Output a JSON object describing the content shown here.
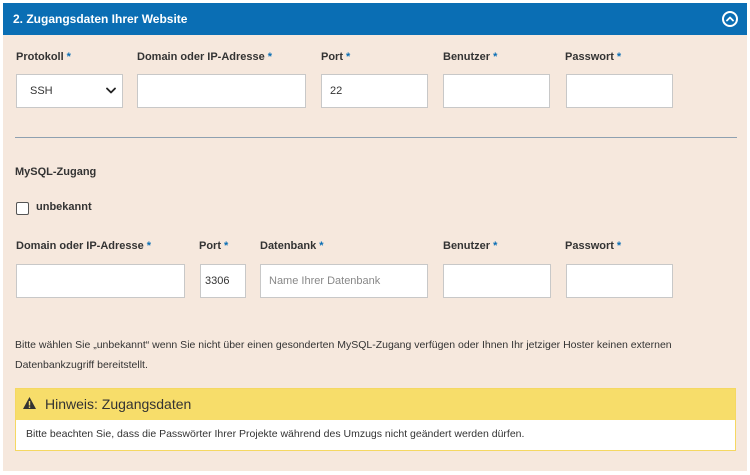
{
  "header": {
    "title": "2. Zugangsdaten Ihrer Website"
  },
  "required_mark": "*",
  "website": {
    "protocol": {
      "label": "Protokoll",
      "value": "SSH"
    },
    "domain": {
      "label": "Domain oder IP-Adresse",
      "value": "",
      "placeholder": ""
    },
    "port": {
      "label": "Port",
      "value": "22"
    },
    "user": {
      "label": "Benutzer",
      "value": ""
    },
    "password": {
      "label": "Passwort",
      "value": ""
    }
  },
  "mysql": {
    "title": "MySQL-Zugang",
    "unknown_label": "unbekannt",
    "unknown_checked": false,
    "domain": {
      "label": "Domain oder IP-Adresse",
      "value": ""
    },
    "port": {
      "label": "Port",
      "value": "3306"
    },
    "database": {
      "label": "Datenbank",
      "value": "",
      "placeholder": "Name Ihrer Datenbank"
    },
    "user": {
      "label": "Benutzer",
      "value": ""
    },
    "password": {
      "label": "Passwort",
      "value": ""
    },
    "info": "Bitte wählen Sie „unbekannt“ wenn Sie nicht über einen gesonderten MySQL-Zugang verfügen oder Ihnen Ihr jetziger Hoster keinen externen Datenbankzugriff bereitstellt."
  },
  "notice": {
    "title": "Hinweis: Zugangsdaten",
    "text": "Bitte beachten Sie, dass die Passwörter Ihrer Projekte während des Umzugs nicht geändert werden dürfen."
  },
  "colors": {
    "header_bg": "#0a6eb4",
    "panel_bg": "#f6e8dd",
    "required": "#0a6eb4",
    "notice_bg": "#f7dd6a"
  },
  "icons": {
    "collapse": "chevron-up-circle-icon",
    "dropdown": "chevron-down-icon",
    "warning": "warning-triangle-icon"
  }
}
